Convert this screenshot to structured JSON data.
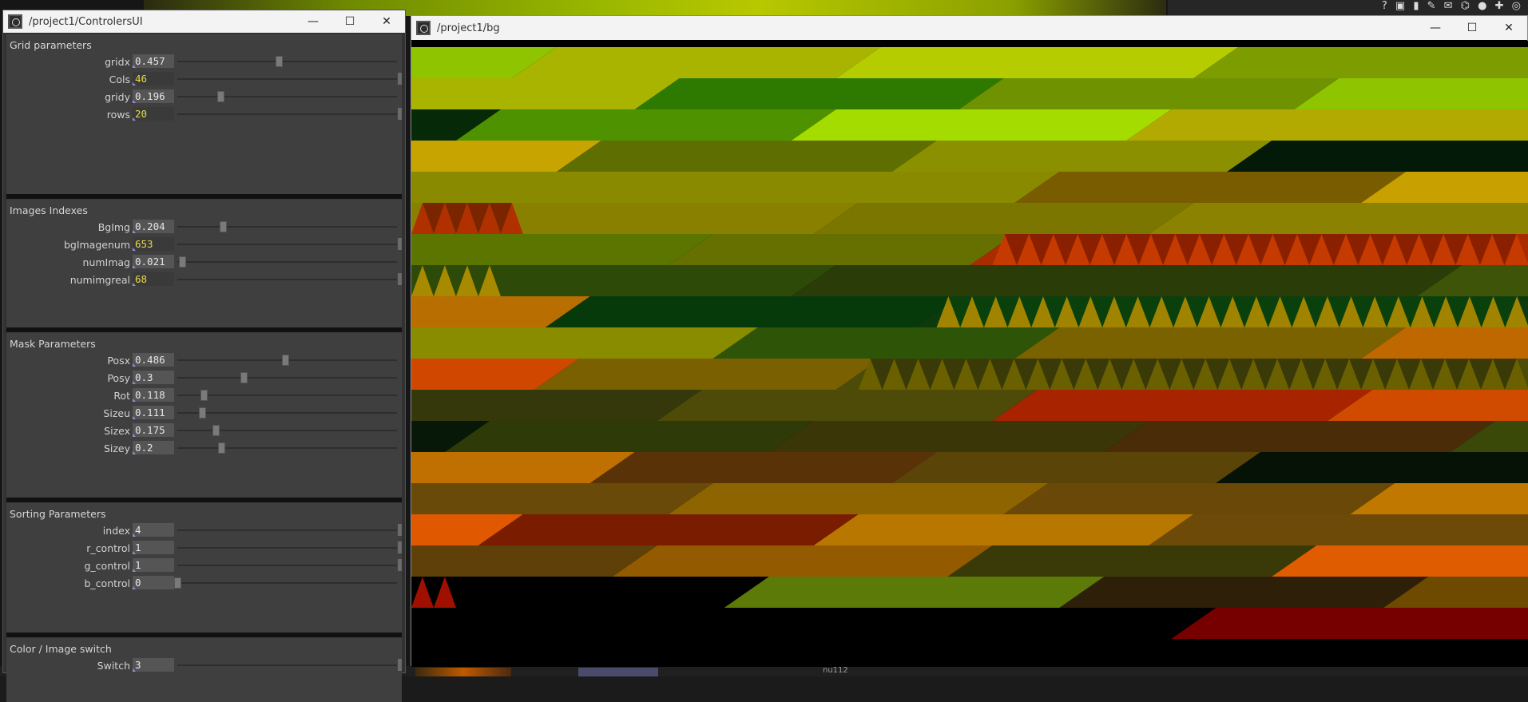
{
  "controllers_window": {
    "title": "/project1/ControlersUI",
    "sections": [
      {
        "title": "Grid parameters",
        "params": [
          {
            "label": "gridx",
            "value": "0.457",
            "kind": "float",
            "level": 0.457
          },
          {
            "label": "Cols",
            "value": "46",
            "kind": "int",
            "level": 1.0
          },
          {
            "label": "gridy",
            "value": "0.196",
            "kind": "float",
            "level": 0.196
          },
          {
            "label": "rows",
            "value": "20",
            "kind": "int",
            "level": 1.0
          }
        ]
      },
      {
        "title": "Images Indexes",
        "params": [
          {
            "label": "BgImg",
            "value": "0.204",
            "kind": "float",
            "level": 0.204
          },
          {
            "label": "bgImagenum",
            "value": "653",
            "kind": "int",
            "level": 1.0
          },
          {
            "label": "numImag",
            "value": "0.021",
            "kind": "float",
            "level": 0.021
          },
          {
            "label": "numimgreal",
            "value": "68",
            "kind": "int",
            "level": 1.0
          }
        ]
      },
      {
        "title": "Mask Parameters",
        "params": [
          {
            "label": "Posx",
            "value": "0.486",
            "kind": "float",
            "level": 0.486
          },
          {
            "label": "Posy",
            "value": "0.3",
            "kind": "float",
            "level": 0.3
          },
          {
            "label": "Rot",
            "value": "0.118",
            "kind": "float",
            "level": 0.118
          },
          {
            "label": "Sizeu",
            "value": "0.111",
            "kind": "float",
            "level": 0.111
          },
          {
            "label": "Sizex",
            "value": "0.175",
            "kind": "float",
            "level": 0.175
          },
          {
            "label": "Sizey",
            "value": "0.2",
            "kind": "float",
            "level": 0.2
          }
        ]
      },
      {
        "title": "Sorting Parameters",
        "params": [
          {
            "label": "index",
            "value": "4",
            "kind": "float",
            "level": 1.0
          },
          {
            "label": "r_control",
            "value": "1",
            "kind": "float",
            "level": 1.0
          },
          {
            "label": "g_control",
            "value": "1",
            "kind": "float",
            "level": 1.0
          },
          {
            "label": "b_control",
            "value": "0",
            "kind": "float",
            "level": 0.0
          }
        ]
      },
      {
        "title": "Color / Image switch",
        "params": [
          {
            "label": "Switch",
            "value": "3",
            "kind": "float",
            "level": 1.0
          }
        ]
      }
    ]
  },
  "bg_window": {
    "title": "/project1/bg",
    "rows": [
      {
        "bands": [
          [
            "#8ec400",
            "#a8b400",
            0,
            0.11
          ],
          [
            "#a8b400",
            "#a8b400",
            0.11,
            0.4
          ],
          [
            "#b4cc00",
            "#b4cc00",
            0.4,
            0.72
          ],
          [
            "#7c9c00",
            "#7c9c00",
            0.72,
            1
          ]
        ],
        "tri": null
      },
      {
        "bands": [
          [
            "#a8b400",
            "#a8b400",
            0,
            0.22
          ],
          [
            "#2e7a00",
            "#2e7a00",
            0.22,
            0.51
          ],
          [
            "#6f9200",
            "#6f9200",
            0.51,
            0.81
          ],
          [
            "#8ec400",
            "#8ec400",
            0.81,
            1
          ]
        ],
        "tri": null
      },
      {
        "bands": [
          [
            "#062a08",
            "#062a08",
            0,
            0.06
          ],
          [
            "#4f9200",
            "#4f9200",
            0.06,
            0.36
          ],
          [
            "#a4dc00",
            "#a4dc00",
            0.36,
            0.66
          ],
          [
            "#b2aa00",
            "#b2aa00",
            0.66,
            1
          ]
        ],
        "tri": null
      },
      {
        "bands": [
          [
            "#c8a400",
            "#c8a400",
            0,
            0.15
          ],
          [
            "#5e6e00",
            "#5e6e00",
            0.15,
            0.45
          ],
          [
            "#8a9000",
            "#8a9000",
            0.45,
            0.75
          ],
          [
            "#041a08",
            "#041a08",
            0.75,
            1
          ]
        ],
        "tri": null
      },
      {
        "bands": [
          [
            "#8a8a00",
            "#8a8a00",
            0,
            0.56
          ],
          [
            "#7a5c00",
            "#7a5c00",
            0.56,
            0.87
          ],
          [
            "#c8a000",
            "#c8a000",
            0.87,
            1
          ]
        ],
        "tri": null
      },
      {
        "bands": [
          [
            "#8a8000",
            "#8a8000",
            0,
            0.38
          ],
          [
            "#7a7600",
            "#7a7600",
            0.38,
            0.68
          ],
          [
            "#8a8200",
            "#8a8200",
            0.68,
            1
          ]
        ],
        "tri": {
          "from": 0,
          "to": 0.1,
          "a": "#b03000",
          "b": "#7a2400"
        }
      },
      {
        "bands": [
          [
            "#5c7400",
            "#5c7400",
            0,
            0.25
          ],
          [
            "#667000",
            "#667000",
            0.25,
            0.52
          ],
          [
            "#a82c00",
            "#a82c00",
            0.52,
            1
          ]
        ],
        "tri": {
          "from": 0.52,
          "to": 1,
          "a": "#c43a00",
          "b": "#8a2000"
        }
      },
      {
        "bands": [
          [
            "#2e4a08",
            "#2e4a08",
            0,
            0.36
          ],
          [
            "#2a3c08",
            "#2a3c08",
            0.36,
            0.92
          ],
          [
            "#3e5408",
            "#3e5408",
            0.92,
            1
          ]
        ],
        "tri": {
          "from": 0,
          "to": 0.08,
          "a": "#a88a00",
          "b": "#2e4a08"
        }
      },
      {
        "bands": [
          [
            "#b86e00",
            "#b86e00",
            0,
            0.14
          ],
          [
            "#073a0a",
            "#073a0a",
            0.14,
            0.47
          ],
          [
            "#0c3a0c",
            "#0c3a0c",
            0.47,
            1
          ]
        ],
        "tri": {
          "from": 0.47,
          "to": 1,
          "a": "#a08400",
          "b": "#0a400c"
        }
      },
      {
        "bands": [
          [
            "#8a8c00",
            "#8a8c00",
            0,
            0.29
          ],
          [
            "#2e5408",
            "#2e5408",
            0.29,
            0.56
          ],
          [
            "#7a6200",
            "#7a6200",
            0.56,
            0.87
          ],
          [
            "#c06800",
            "#c06800",
            0.87,
            1
          ]
        ],
        "tri": null
      },
      {
        "bands": [
          [
            "#d04800",
            "#d04800",
            0,
            0.13
          ],
          [
            "#7a6000",
            "#7a6000",
            0.13,
            0.4
          ],
          [
            "#4c4c08",
            "#4c4c08",
            0.4,
            1
          ]
        ],
        "tri": {
          "from": 0.4,
          "to": 1,
          "a": "#6a6000",
          "b": "#3a3a08"
        }
      },
      {
        "bands": [
          [
            "#34380a",
            "#34380a",
            0,
            0.24
          ],
          [
            "#4e4a08",
            "#4e4a08",
            0.24,
            0.54
          ],
          [
            "#a82400",
            "#a82400",
            0.54,
            0.84
          ],
          [
            "#d04a00",
            "#d04a00",
            0.84,
            1
          ]
        ],
        "tri": null
      },
      {
        "bands": [
          [
            "#081808",
            "#081808",
            0,
            0.05
          ],
          [
            "#2e3a08",
            "#2e3a08",
            0.05,
            0.34
          ],
          [
            "#3a3608",
            "#3a3608",
            0.34,
            0.64
          ],
          [
            "#4a2c08",
            "#4a2c08",
            0.64,
            0.95
          ],
          [
            "#3a4808",
            "#3a4808",
            0.95,
            1
          ]
        ],
        "tri": null
      },
      {
        "bands": [
          [
            "#c07000",
            "#c07000",
            0,
            0.18
          ],
          [
            "#5a3208",
            "#5a3208",
            0.18,
            0.45
          ],
          [
            "#5a4408",
            "#5a4408",
            0.45,
            0.74
          ],
          [
            "#061206",
            "#061206",
            0.74,
            1
          ]
        ],
        "tri": null
      },
      {
        "bands": [
          [
            "#6a4a08",
            "#6a4a08",
            0,
            0.25
          ],
          [
            "#8e6400",
            "#8e6400",
            0.25,
            0.55
          ],
          [
            "#6a4808",
            "#6a4808",
            0.55,
            0.86
          ],
          [
            "#c07800",
            "#c07800",
            0.86,
            1
          ]
        ],
        "tri": null
      },
      {
        "bands": [
          [
            "#e05800",
            "#e05800",
            0,
            0.08
          ],
          [
            "#7a1c00",
            "#7a1c00",
            0.08,
            0.38
          ],
          [
            "#b87800",
            "#b87800",
            0.38,
            0.68
          ],
          [
            "#6e4a08",
            "#6e4a08",
            0.68,
            1
          ]
        ],
        "tri": null
      },
      {
        "bands": [
          [
            "#5e4008",
            "#5e4008",
            0,
            0.2
          ],
          [
            "#945a00",
            "#945a00",
            0.2,
            0.5
          ],
          [
            "#3a3a08",
            "#3a3a08",
            0.5,
            0.79
          ],
          [
            "#e05c00",
            "#e05c00",
            0.79,
            1
          ]
        ],
        "tri": null
      },
      {
        "bands": [
          [
            "#000000",
            "#000000",
            0,
            0.3
          ],
          [
            "#5c7a08",
            "#5c7a08",
            0.3,
            0.6
          ],
          [
            "#2e2008",
            "#2e2008",
            0.6,
            0.89
          ],
          [
            "#6e4a00",
            "#6e4a00",
            0.89,
            1
          ]
        ],
        "tri": {
          "from": 0,
          "to": 0.04,
          "a": "#a01000",
          "b": "#000000"
        }
      },
      {
        "bands": [
          [
            "#000000",
            "#000000",
            0,
            0.7
          ],
          [
            "#760000",
            "#760000",
            0.7,
            1
          ]
        ],
        "tri": null
      },
      {
        "bands": [
          [
            "#000000",
            "#000000",
            0,
            1
          ]
        ],
        "tri": null
      }
    ]
  },
  "host": {
    "bottom_label": "nu112"
  }
}
